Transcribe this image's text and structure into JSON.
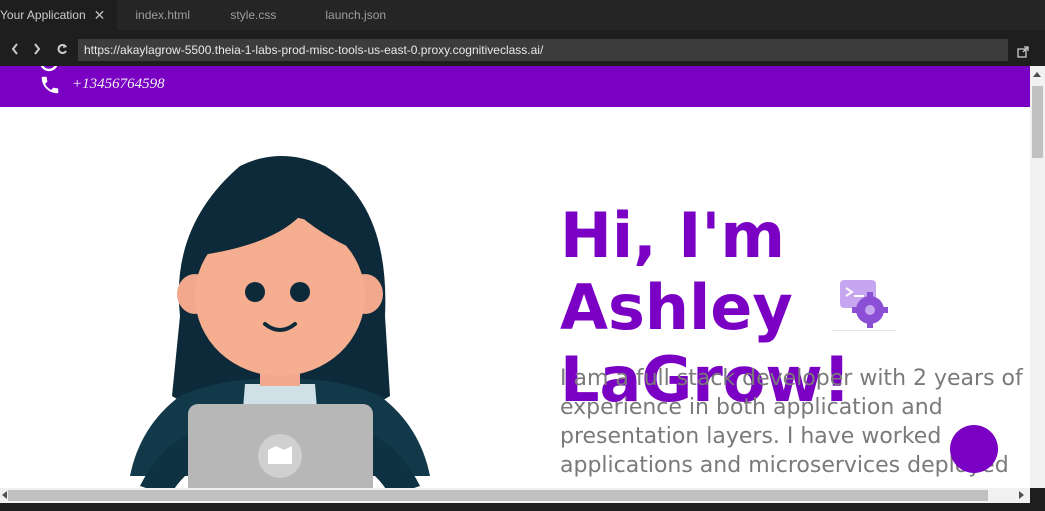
{
  "tabs": [
    {
      "label": "Your Application",
      "active": true
    },
    {
      "label": "index.html"
    },
    {
      "label": "style.css"
    },
    {
      "label": "launch.json"
    }
  ],
  "browser": {
    "url": "https://akaylagrow-5500.theia-1-labs-prod-misc-tools-us-east-0.proxy.cognitiveclass.ai/"
  },
  "contact": {
    "phone": "+13456764598"
  },
  "hero": {
    "title_line1": "Hi, I'm Ashley",
    "title_line2": "LaGrow!",
    "description": "I am a full stack developer with 2 years of experience in both application and presentation layers. I have worked on applications and microservices deployed on IBM Cloud...",
    "description_visible": "I am a full stack developer with 2 years of experience in both application and presentation layers. I have worked applications and microservices deployed"
  },
  "colors": {
    "accent": "#7a00c4",
    "text_gray": "#7a7a7a",
    "editor_bg": "#1e1e1e"
  },
  "icons": {
    "close": "close-icon",
    "back": "chevron-left-icon",
    "forward": "chevron-right-icon",
    "reload": "reload-icon",
    "external": "external-link-icon",
    "phone": "phone-icon",
    "gear": "code-gear-icon"
  }
}
